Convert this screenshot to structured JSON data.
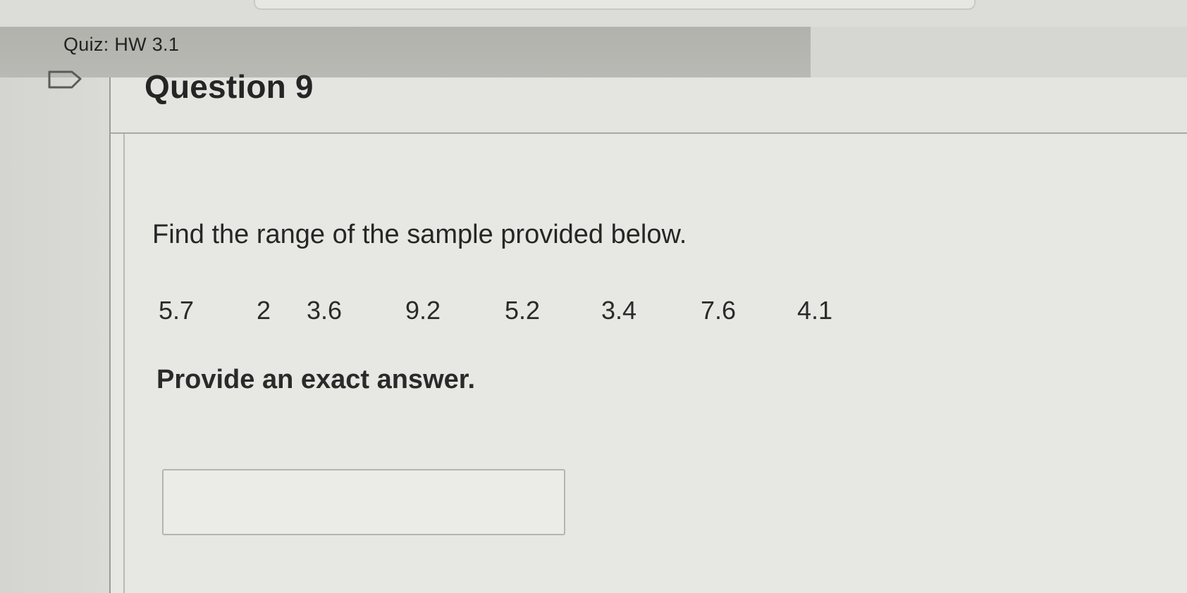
{
  "quiz": {
    "title": "Quiz: HW 3.1"
  },
  "question": {
    "title": "Question 9",
    "prompt": "Find the range of the sample provided below.",
    "sample_values": [
      "5.7",
      "2",
      "3.6",
      "9.2",
      "5.2",
      "3.4",
      "7.6",
      "4.1"
    ],
    "instruction": "Provide an exact answer.",
    "answer": {
      "value": "",
      "placeholder": ""
    }
  },
  "icons": {
    "bookmark": "bookmark-icon"
  }
}
